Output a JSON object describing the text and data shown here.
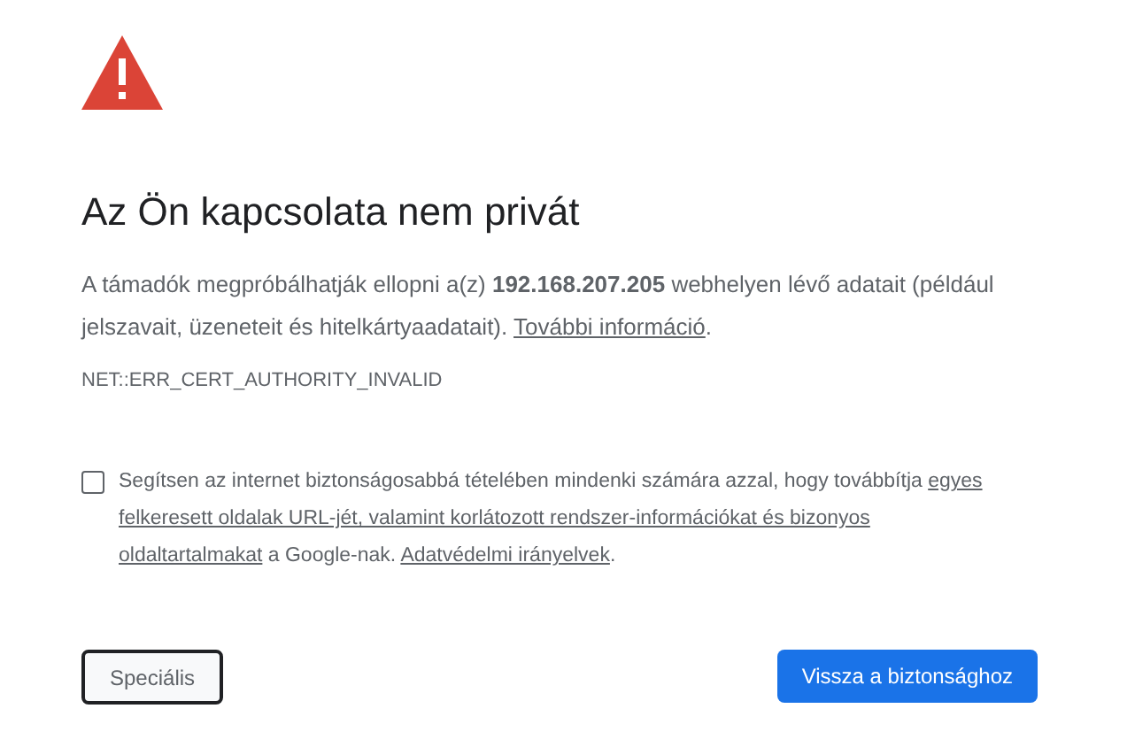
{
  "title": "Az Ön kapcsolata nem privát",
  "message": "A támadók megpróbálhatják ellopni a(z) **192.168.207.205** webhelyen lévő adatait (például jelszavait, üzeneteit és hitelkártyaadatait).",
  "more_info_link": "További információ",
  "message_end": ".",
  "error_code": "NET::ERR_CERT_AUTHORITY_INVALID",
  "consent": {
    "checked": false,
    "parts": [
      {
        "kind": "text",
        "text": "Segítsen az internet biztonságosabbá tételében mindenki számára azzal, hogy továbbítja "
      },
      {
        "kind": "link",
        "text": "egyes"
      },
      {
        "kind": "link",
        "text": "felkeresett oldalak URL-jét, valamint korlátozott rendszer-információkat és bizonyos"
      },
      {
        "kind": "link",
        "text": "oldaltartalmakat"
      },
      {
        "kind": "text",
        "text": " a Google-nak. "
      },
      {
        "kind": "link",
        "text": "Adatvédelmi irányelvek"
      },
      {
        "kind": "text",
        "text": "."
      }
    ]
  },
  "buttons": [
    {
      "kind": "secondary",
      "label": "Speciális"
    },
    {
      "kind": "primary",
      "label": "Vissza a biztonsághoz"
    }
  ]
}
